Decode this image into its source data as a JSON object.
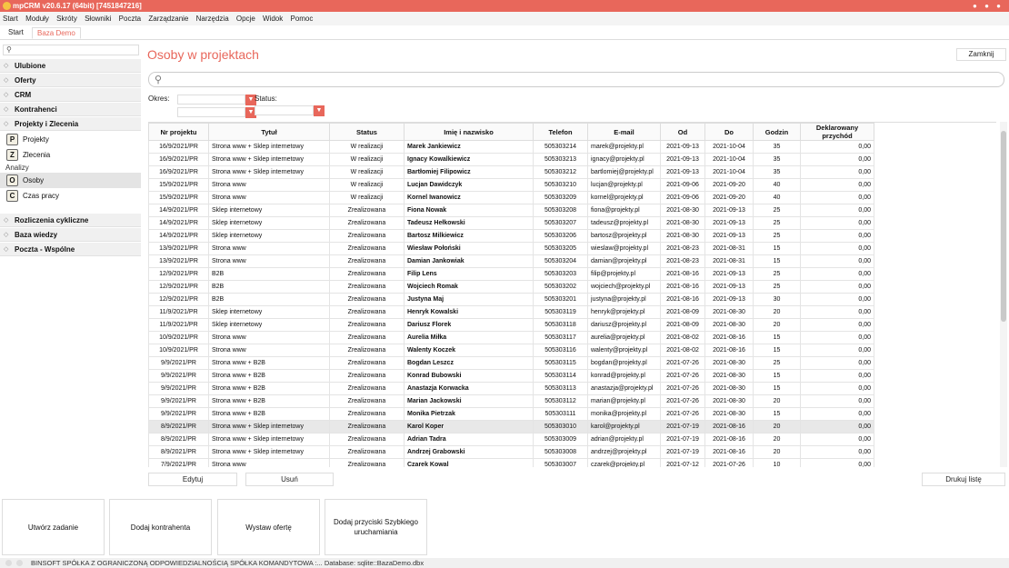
{
  "window": {
    "title": "mpCRM v20.6.17 (64bit) [7451847216]"
  },
  "menu": [
    "Start",
    "Moduły",
    "Skróty",
    "Słowniki",
    "Poczta",
    "Zarządzanie",
    "Narzędzia",
    "Opcje",
    "Widok",
    "Pomoc"
  ],
  "tabs": [
    "Start",
    "Baza Demo"
  ],
  "sidebar": {
    "search_icon": "search-icon",
    "sections_top": [
      "Ulubione",
      "Oferty",
      "CRM",
      "Kontrahenci",
      "Projekty i Zlecenia"
    ],
    "items_a": [
      "Projekty",
      "Zlecenia"
    ],
    "category": "Analizy",
    "items_b": [
      "Osoby",
      "Czas pracy"
    ],
    "sections_bottom": [
      "Rozliczenia cykliczne",
      "Baza wiedzy",
      "Poczta - Wspólne"
    ]
  },
  "page": {
    "title": "Osoby w projektach",
    "close_label": "Zamknij",
    "period_label": "Okres:",
    "status_label": "Status:"
  },
  "table": {
    "columns": [
      "Nr projektu",
      "Tytuł",
      "Status",
      "Imię i nazwisko",
      "Telefon",
      "E-mail",
      "Od",
      "Do",
      "Godzin",
      "Deklarowany przychód"
    ],
    "rows": [
      [
        "16/9/2021/PR",
        "Strona www + Sklep internetowy",
        "W realizacji",
        "Marek Jankiewicz",
        "505303214",
        "marek@projekty.pl",
        "2021-09-13",
        "2021-10-04",
        "35",
        "0,00"
      ],
      [
        "16/9/2021/PR",
        "Strona www + Sklep internetowy",
        "W realizacji",
        "Ignacy Kowalkiewicz",
        "505303213",
        "ignacy@projekty.pl",
        "2021-09-13",
        "2021-10-04",
        "35",
        "0,00"
      ],
      [
        "16/9/2021/PR",
        "Strona www + Sklep internetowy",
        "W realizacji",
        "Bartłomiej Filipowicz",
        "505303212",
        "bartlomiej@projekty.pl",
        "2021-09-13",
        "2021-10-04",
        "35",
        "0,00"
      ],
      [
        "15/9/2021/PR",
        "Strona www",
        "W realizacji",
        "Lucjan Dawidczyk",
        "505303210",
        "lucjan@projekty.pl",
        "2021-09-06",
        "2021-09-20",
        "40",
        "0,00"
      ],
      [
        "15/9/2021/PR",
        "Strona www",
        "W realizacji",
        "Kornel Iwanowicz",
        "505303209",
        "kornel@projekty.pl",
        "2021-09-06",
        "2021-09-20",
        "40",
        "0,00"
      ],
      [
        "14/9/2021/PR",
        "Sklep internetowy",
        "Zrealizowana",
        "Fiona Nowak",
        "505303208",
        "fiona@projekty.pl",
        "2021-08-30",
        "2021-09-13",
        "25",
        "0,00"
      ],
      [
        "14/9/2021/PR",
        "Sklep internetowy",
        "Zrealizowana",
        "Tadeusz Hełkowski",
        "505303207",
        "tadeusz@projekty.pl",
        "2021-08-30",
        "2021-09-13",
        "25",
        "0,00"
      ],
      [
        "14/9/2021/PR",
        "Sklep internetowy",
        "Zrealizowana",
        "Bartosz Milkiewicz",
        "505303206",
        "bartosz@projekty.pl",
        "2021-08-30",
        "2021-09-13",
        "25",
        "0,00"
      ],
      [
        "13/9/2021/PR",
        "Strona www",
        "Zrealizowana",
        "Wiesław Połoński",
        "505303205",
        "wieslaw@projekty.pl",
        "2021-08-23",
        "2021-08-31",
        "15",
        "0,00"
      ],
      [
        "13/9/2021/PR",
        "Strona www",
        "Zrealizowana",
        "Damian Jankowiak",
        "505303204",
        "damian@projekty.pl",
        "2021-08-23",
        "2021-08-31",
        "15",
        "0,00"
      ],
      [
        "12/9/2021/PR",
        "B2B",
        "Zrealizowana",
        "Filip Lens",
        "505303203",
        "filip@projekty.pl",
        "2021-08-16",
        "2021-09-13",
        "25",
        "0,00"
      ],
      [
        "12/9/2021/PR",
        "B2B",
        "Zrealizowana",
        "Wojciech Romak",
        "505303202",
        "wojciech@projekty.pl",
        "2021-08-16",
        "2021-09-13",
        "25",
        "0,00"
      ],
      [
        "12/9/2021/PR",
        "B2B",
        "Zrealizowana",
        "Justyna Maj",
        "505303201",
        "justyna@projekty.pl",
        "2021-08-16",
        "2021-09-13",
        "30",
        "0,00"
      ],
      [
        "11/9/2021/PR",
        "Sklep internetowy",
        "Zrealizowana",
        "Henryk Kowalski",
        "505303119",
        "henryk@projekty.pl",
        "2021-08-09",
        "2021-08-30",
        "20",
        "0,00"
      ],
      [
        "11/9/2021/PR",
        "Sklep internetowy",
        "Zrealizowana",
        "Dariusz Florek",
        "505303118",
        "dariusz@projekty.pl",
        "2021-08-09",
        "2021-08-30",
        "20",
        "0,00"
      ],
      [
        "10/9/2021/PR",
        "Strona www",
        "Zrealizowana",
        "Aurelia Miłka",
        "505303117",
        "aurelia@projekty.pl",
        "2021-08-02",
        "2021-08-16",
        "15",
        "0,00"
      ],
      [
        "10/9/2021/PR",
        "Strona www",
        "Zrealizowana",
        "Walenty Koczek",
        "505303116",
        "walenty@projekty.pl",
        "2021-08-02",
        "2021-08-16",
        "15",
        "0,00"
      ],
      [
        "9/9/2021/PR",
        "Strona www + B2B",
        "Zrealizowana",
        "Bogdan Leszcz",
        "505303115",
        "bogdan@projekty.pl",
        "2021-07-26",
        "2021-08-30",
        "25",
        "0,00"
      ],
      [
        "9/9/2021/PR",
        "Strona www + B2B",
        "Zrealizowana",
        "Konrad Bubowski",
        "505303114",
        "konrad@projekty.pl",
        "2021-07-26",
        "2021-08-30",
        "15",
        "0,00"
      ],
      [
        "9/9/2021/PR",
        "Strona www + B2B",
        "Zrealizowana",
        "Anastazja Korwacka",
        "505303113",
        "anastazja@projekty.pl",
        "2021-07-26",
        "2021-08-30",
        "15",
        "0,00"
      ],
      [
        "9/9/2021/PR",
        "Strona www + B2B",
        "Zrealizowana",
        "Marian Jackowski",
        "505303112",
        "marian@projekty.pl",
        "2021-07-26",
        "2021-08-30",
        "20",
        "0,00"
      ],
      [
        "9/9/2021/PR",
        "Strona www + B2B",
        "Zrealizowana",
        "Monika Pietrzak",
        "505303111",
        "monika@projekty.pl",
        "2021-07-26",
        "2021-08-30",
        "15",
        "0,00"
      ],
      [
        "8/9/2021/PR",
        "Strona www + Sklep internetowy",
        "Zrealizowana",
        "Karol Koper",
        "505303010",
        "karol@projekty.pl",
        "2021-07-19",
        "2021-08-16",
        "20",
        "0,00"
      ],
      [
        "8/9/2021/PR",
        "Strona www + Sklep internetowy",
        "Zrealizowana",
        "Adrian Tadra",
        "505303009",
        "adrian@projekty.pl",
        "2021-07-19",
        "2021-08-16",
        "20",
        "0,00"
      ],
      [
        "8/9/2021/PR",
        "Strona www + Sklep internetowy",
        "Zrealizowana",
        "Andrzej Grabowski",
        "505303008",
        "andrzej@projekty.pl",
        "2021-07-19",
        "2021-08-16",
        "20",
        "0,00"
      ],
      [
        "7/9/2021/PR",
        "Strona www",
        "Zrealizowana",
        "Czarek Kowal",
        "505303007",
        "czarek@projekty.pl",
        "2021-07-12",
        "2021-07-26",
        "10",
        "0,00"
      ]
    ],
    "highlighted_row": 22
  },
  "actions": {
    "edit": "Edytuj",
    "delete": "Usuń",
    "print": "Drukuj listę"
  },
  "quick": [
    "Utwórz zadanie",
    "Dodaj kontrahenta",
    "Wystaw ofertę",
    "Dodaj przyciski Szybkiego uruchamiania"
  ],
  "statusbar": {
    "text": "BINSOFT SPÓŁKA Z OGRANICZONĄ ODPOWIEDZIALNOŚCIĄ SPÓŁKA KOMANDYTOWA :... Database: sqlite::BazaDemo.dbx"
  },
  "colors": {
    "accent": "#e8675b"
  }
}
